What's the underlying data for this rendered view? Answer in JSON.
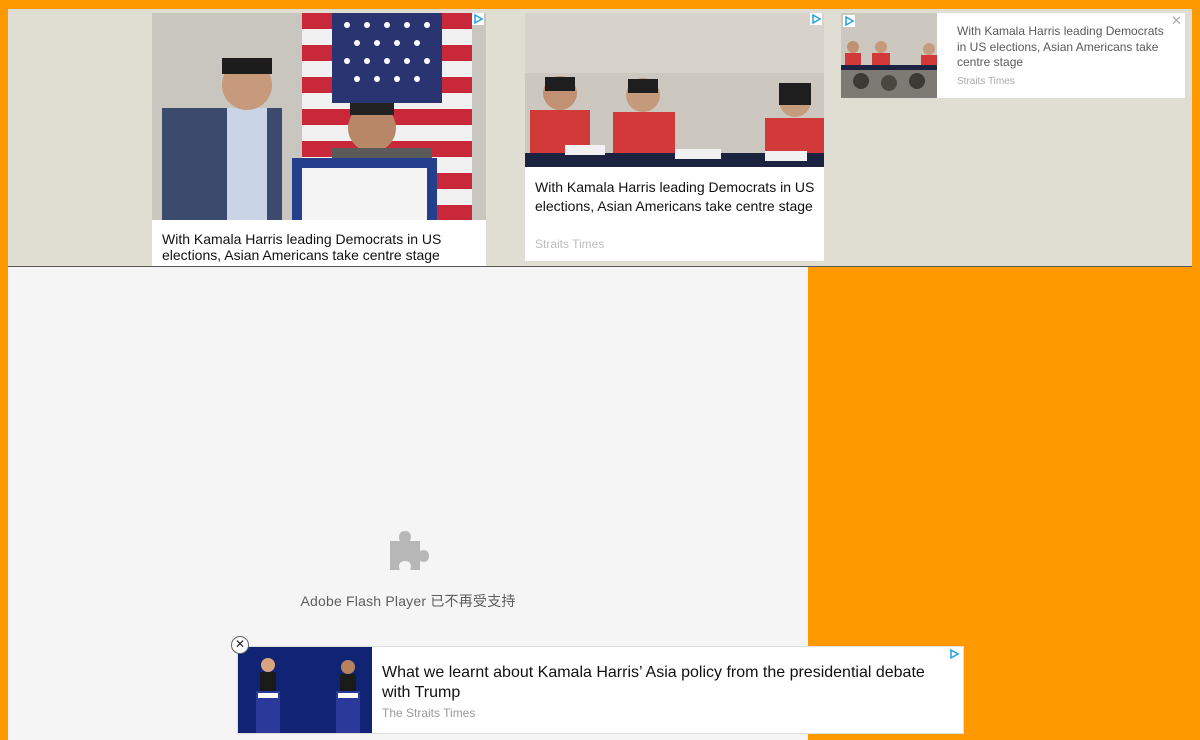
{
  "ads_top": [
    {
      "title": "With Kamala Harris leading Democrats in US elections, Asian Americans take centre stage",
      "image": "photo-man-at-podium-with-us-flag"
    },
    {
      "title": "With Kamala Harris leading Democrats in US elections, Asian Americans take centre stage",
      "source": "Straits Times",
      "image": "photo-panel-three-women-at-table"
    },
    {
      "title": "With Kamala Harris leading Democrats in US elections, Asian Americans take centre stage",
      "source": "Straits Times",
      "image": "photo-panel-thumbnail",
      "close_label": "✕"
    }
  ],
  "flash": {
    "message": "Adobe Flash Player 已不再受支持",
    "icon": "puzzle-piece-icon"
  },
  "bottom_ad": {
    "title": "What we learnt about Kamala Harris’ Asia policy from the presidential debate with Trump",
    "source": "The Straits Times",
    "close_label": "✕",
    "image": "photo-presidential-debate"
  },
  "colors": {
    "page_bg": "#ff9900",
    "ad_strip_bg": "#e0ddd3",
    "adchoice": "#1fa3e0",
    "flash_bg": "#f5f5f5"
  }
}
